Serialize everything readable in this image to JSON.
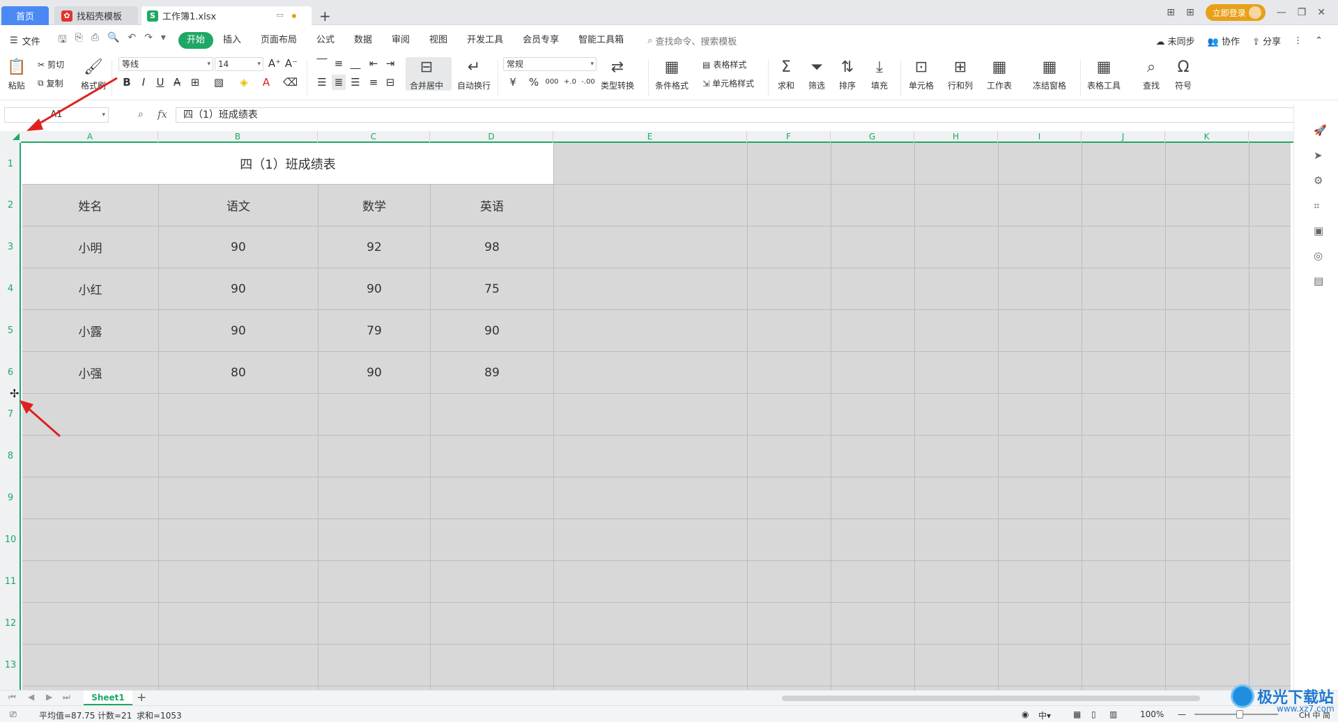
{
  "tabs": {
    "home": "首页",
    "template": "找稻壳模板",
    "doc": "工作簿1.xlsx",
    "new_tab": "+"
  },
  "titlebar": {
    "login": "立即登录",
    "minimize": "—",
    "restore": "❐",
    "close": "✕"
  },
  "menu": {
    "file": "文件",
    "items": [
      "开始",
      "插入",
      "页面布局",
      "公式",
      "数据",
      "审阅",
      "视图",
      "开发工具",
      "会员专享",
      "智能工具箱"
    ],
    "active": "开始",
    "search_placeholder": "查找命令、搜索模板",
    "sync": "未同步",
    "collab": "协作",
    "share": "分享"
  },
  "ribbon": {
    "paste": "粘贴",
    "cut": "剪切",
    "copy": "复制",
    "format_painter": "格式刷",
    "font_name": "等线",
    "font_size": "14",
    "merge_center": "合并居中",
    "wrap_text": "自动换行",
    "number_format": "常规",
    "type_convert": "类型转换",
    "cond_format": "条件格式",
    "table_style": "表格样式",
    "cell_style": "单元格样式",
    "sum": "求和",
    "filter": "筛选",
    "sort": "排序",
    "fill": "填充",
    "cell": "单元格",
    "row_col": "行和列",
    "worksheet": "工作表",
    "freeze": "冻结窗格",
    "table_tools": "表格工具",
    "find": "查找",
    "symbol": "符号"
  },
  "formula_bar": {
    "name_box": "A1",
    "fx": "fx",
    "value": "四（1）班成绩表"
  },
  "columns": [
    "A",
    "B",
    "C",
    "D",
    "E",
    "F",
    "G",
    "H",
    "I",
    "J",
    "K"
  ],
  "rows": [
    "1",
    "2",
    "3",
    "4",
    "5",
    "6",
    "7",
    "8",
    "9",
    "10",
    "11",
    "12",
    "13"
  ],
  "table": {
    "title": "四（1）班成绩表",
    "headers": [
      "姓名",
      "语文",
      "数学",
      "英语"
    ],
    "data": [
      [
        "小明",
        "90",
        "92",
        "98"
      ],
      [
        "小红",
        "90",
        "90",
        "75"
      ],
      [
        "小露",
        "90",
        "79",
        "90"
      ],
      [
        "小强",
        "80",
        "90",
        "89"
      ]
    ]
  },
  "sheets": {
    "active": "Sheet1",
    "add": "+"
  },
  "status": {
    "average": "平均值=87.75",
    "count": "计数=21",
    "sum": "求和=1053",
    "zoom": "100%",
    "input_method": "CH 中 简"
  },
  "watermark": {
    "brand": "极光下载站",
    "url": "www.xz7.com"
  },
  "colors": {
    "accent": "#1fa865",
    "home_tab": "#4a89f3",
    "login": "#e8a019",
    "annotation_arrow": "#e02020",
    "grid_fill": "#d8d8d8"
  }
}
